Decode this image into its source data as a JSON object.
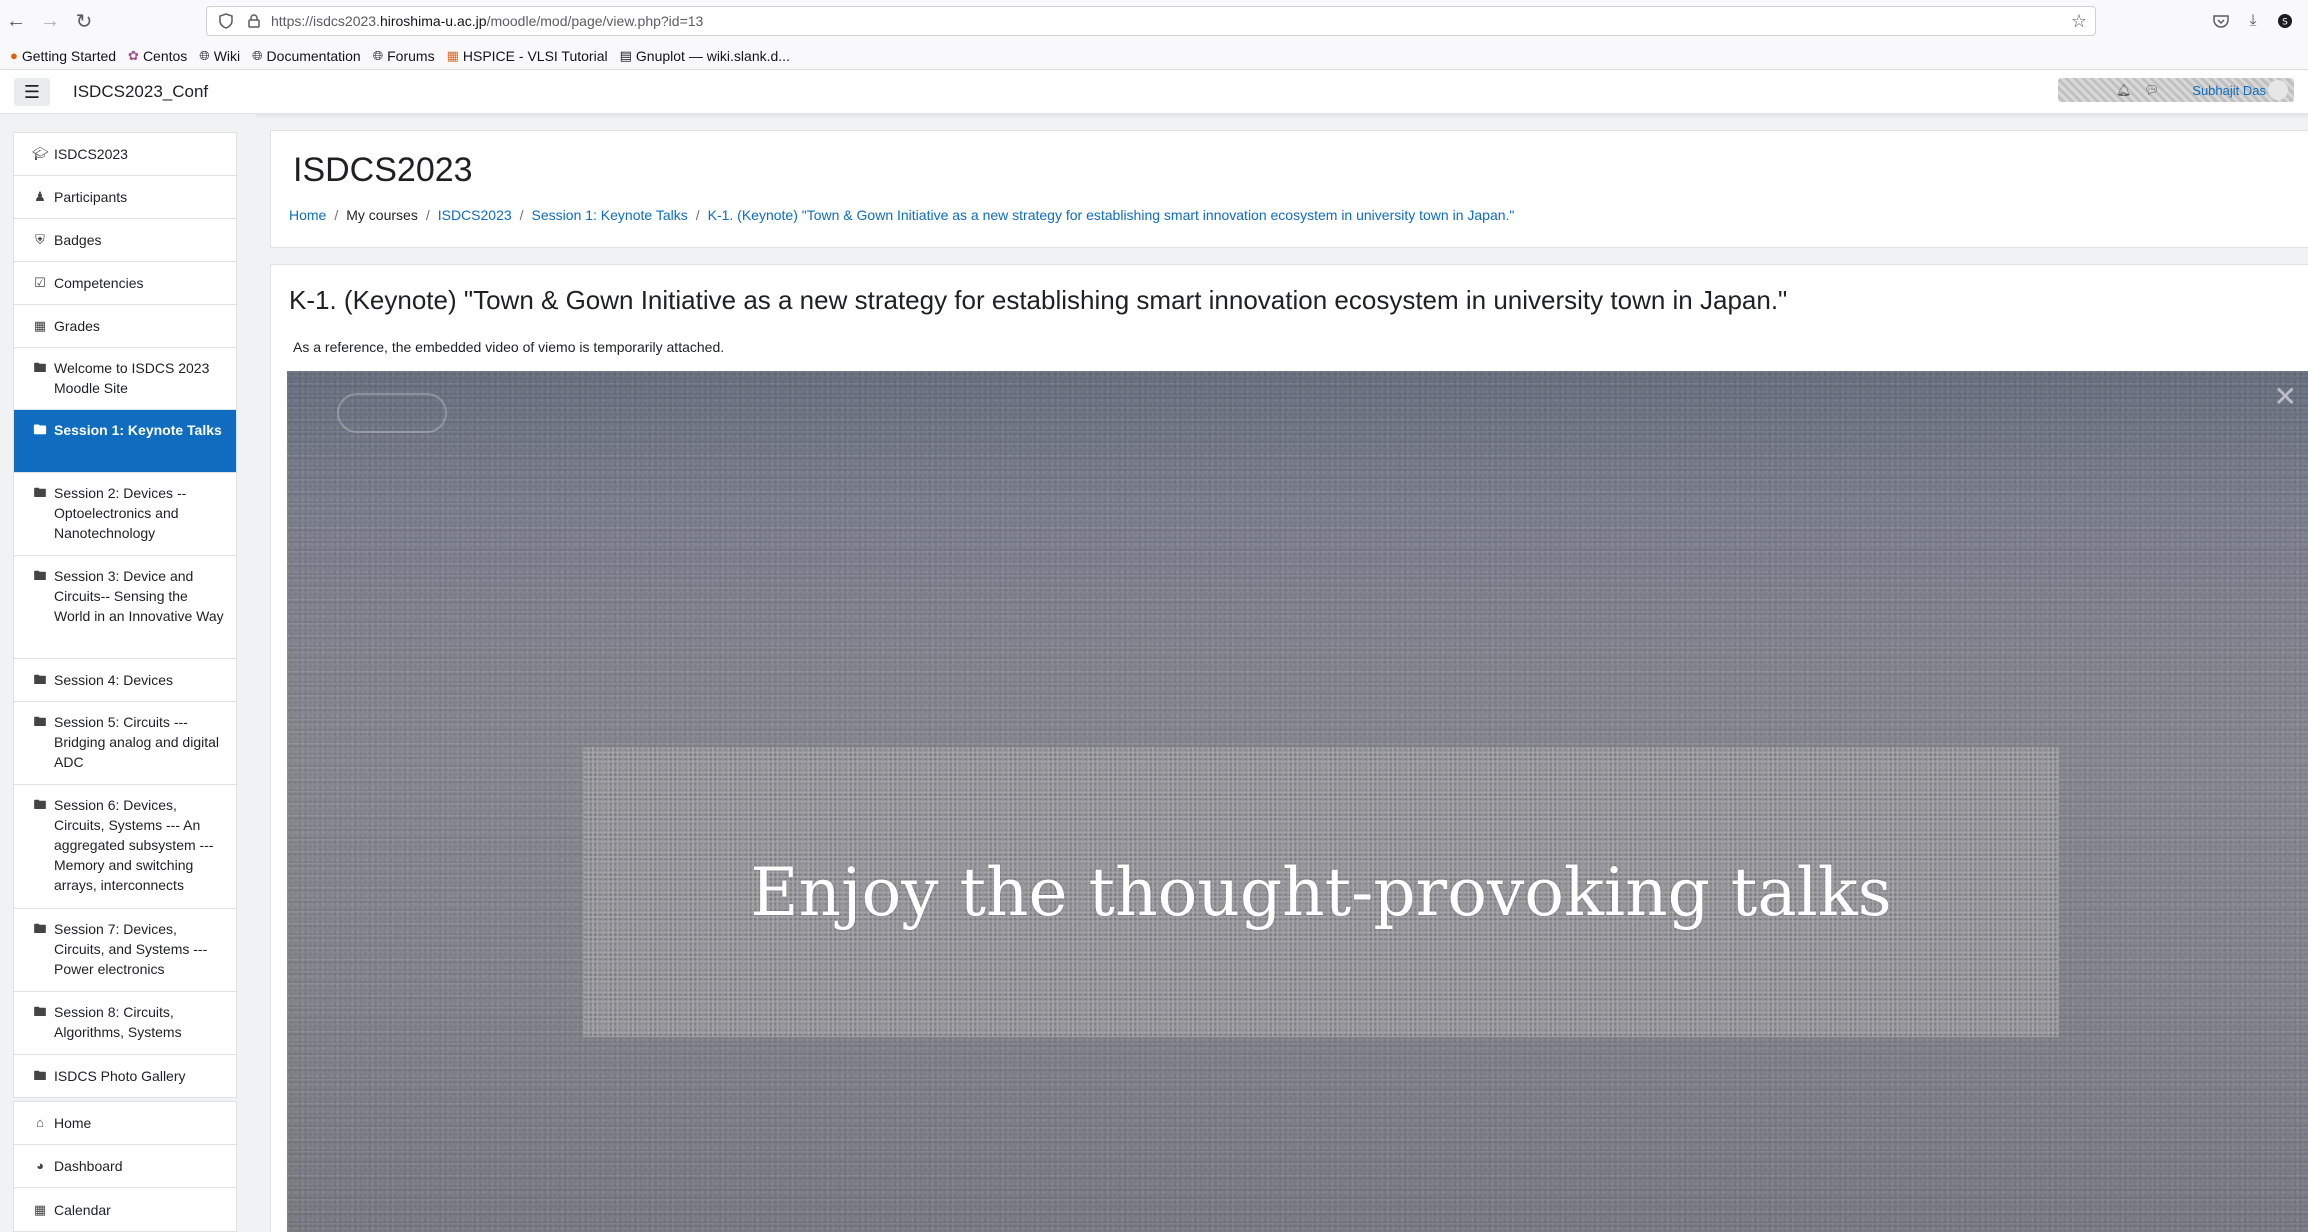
{
  "browser": {
    "url_prefix": "https://isdcs2023.",
    "url_host": "hiroshima-u.ac.jp",
    "url_path": "/moodle/mod/page/view.php?id=13",
    "bookmarks": [
      {
        "label": "Getting Started",
        "icon": "firefox-icon"
      },
      {
        "label": "Centos",
        "icon": "centos-icon"
      },
      {
        "label": "Wiki",
        "icon": "globe-icon"
      },
      {
        "label": "Documentation",
        "icon": "globe-icon"
      },
      {
        "label": "Forums",
        "icon": "globe-icon"
      },
      {
        "label": "HSPICE - VLSI Tutorial",
        "icon": "bookmark-icon"
      },
      {
        "label": "Gnuplot — wiki.slank.d...",
        "icon": "page-icon"
      }
    ]
  },
  "navbar": {
    "site_name": "ISDCS2023_Conf",
    "user_name": "Subhajit Das"
  },
  "drawer": {
    "course_items": [
      {
        "label": "ISDCS2023",
        "icon": "graduation-cap-icon"
      },
      {
        "label": "Participants",
        "icon": "users-icon"
      },
      {
        "label": "Badges",
        "icon": "shield-icon"
      },
      {
        "label": "Competencies",
        "icon": "check-square-icon"
      },
      {
        "label": "Grades",
        "icon": "table-icon"
      },
      {
        "label": "Welcome to ISDCS 2023 Moodle Site",
        "icon": "folder-icon"
      },
      {
        "label": "Session 1: Keynote Talks",
        "icon": "folder-icon",
        "active": true
      },
      {
        "label": "Session 2: Devices -- Optoelectronics and Nanotechnology",
        "icon": "folder-icon"
      },
      {
        "label": "Session 3: Device and Circuits-- Sensing the World in an Innovative Way",
        "icon": "folder-icon"
      },
      {
        "label": "Session 4: Devices",
        "icon": "folder-icon"
      },
      {
        "label": "Session 5: Circuits --- Bridging analog and digital ADC",
        "icon": "folder-icon"
      },
      {
        "label": "Session 6: Devices, Circuits, Systems --- An aggregated subsystem --- Memory and switching arrays, interconnects",
        "icon": "folder-icon"
      },
      {
        "label": "Session 7: Devices, Circuits, and Systems --- Power electronics",
        "icon": "folder-icon"
      },
      {
        "label": "Session 8: Circuits, Algorithms, Systems",
        "icon": "folder-icon"
      },
      {
        "label": "ISDCS Photo Gallery",
        "icon": "folder-icon"
      }
    ],
    "site_items": [
      {
        "label": "Home",
        "icon": "home-icon"
      },
      {
        "label": "Dashboard",
        "icon": "dashboard-icon"
      },
      {
        "label": "Calendar",
        "icon": "calendar-icon"
      }
    ]
  },
  "header": {
    "title": "ISDCS2023",
    "breadcrumb": [
      {
        "label": "Home",
        "link": true
      },
      {
        "label": "My courses",
        "link": false
      },
      {
        "label": "ISDCS2023",
        "link": true
      },
      {
        "label": "Session 1: Keynote Talks",
        "link": true
      },
      {
        "label": "K-1. (Keynote) \"Town & Gown Initiative as a new strategy for establishing smart innovation ecosystem in university town in Japan.\"",
        "link": true
      }
    ]
  },
  "content": {
    "title": "K-1. (Keynote) \"Town & Gown Initiative as a new strategy for establishing smart innovation ecosystem in university town in Japan.\"",
    "intro": "As a reference, the embedded video of viemo is temporarily attached.",
    "video_caption": "Enjoy the thought-provoking talks"
  },
  "colors": {
    "accent": "#0f6cbf",
    "link": "#0f6cbf",
    "drawer_bg": "#f1f2f4"
  }
}
